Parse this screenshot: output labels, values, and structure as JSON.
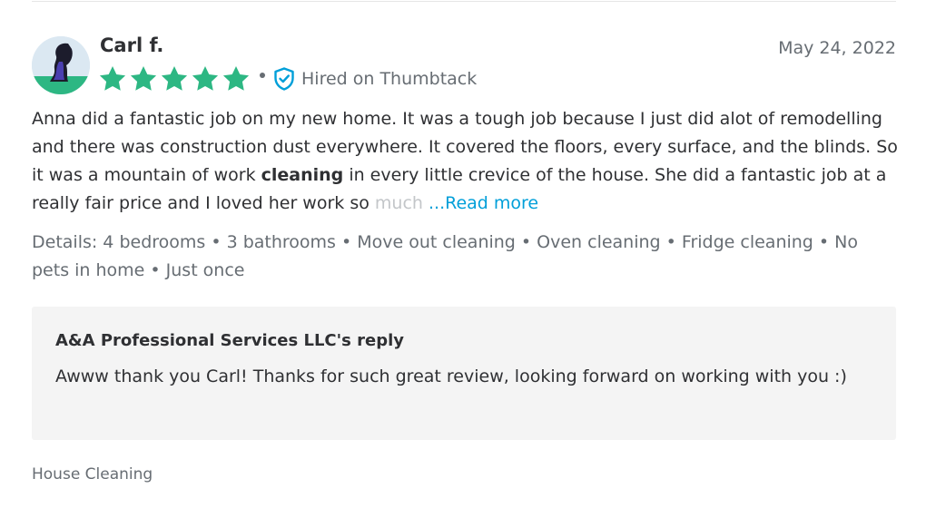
{
  "review": {
    "reviewer_name": "Carl f.",
    "date": "May 24, 2022",
    "rating": 5,
    "rating_max": 5,
    "hired_badge": "Hired on Thumbtack",
    "body_part1": "Anna did a fantastic job on my new home. It was a tough job because I just did alot of remodelling and there was construction dust everywhere. It covered the floors, every surface, and the blinds. So it was a mountain of work ",
    "body_bold": "cleaning",
    "body_part2": " in every little crevice of the house. She did a fantastic job at a really fair price and I loved her work so ",
    "body_faded": "much",
    "read_more": "...Read more",
    "details": "Details: 4 bedrooms • 3 bathrooms • Move out cleaning • Oven cleaning • Fridge cleaning • No pets in home • Just once"
  },
  "reply": {
    "title": "A&A Professional Services LLC's reply",
    "text": "Awww thank you Carl! Thanks for such great review, looking forward on working with you :)"
  },
  "category": "House Cleaning",
  "colors": {
    "star": "#2db783",
    "badge": "#009fd9",
    "link": "#009fd9",
    "reply_bg": "#f4f4f4"
  }
}
